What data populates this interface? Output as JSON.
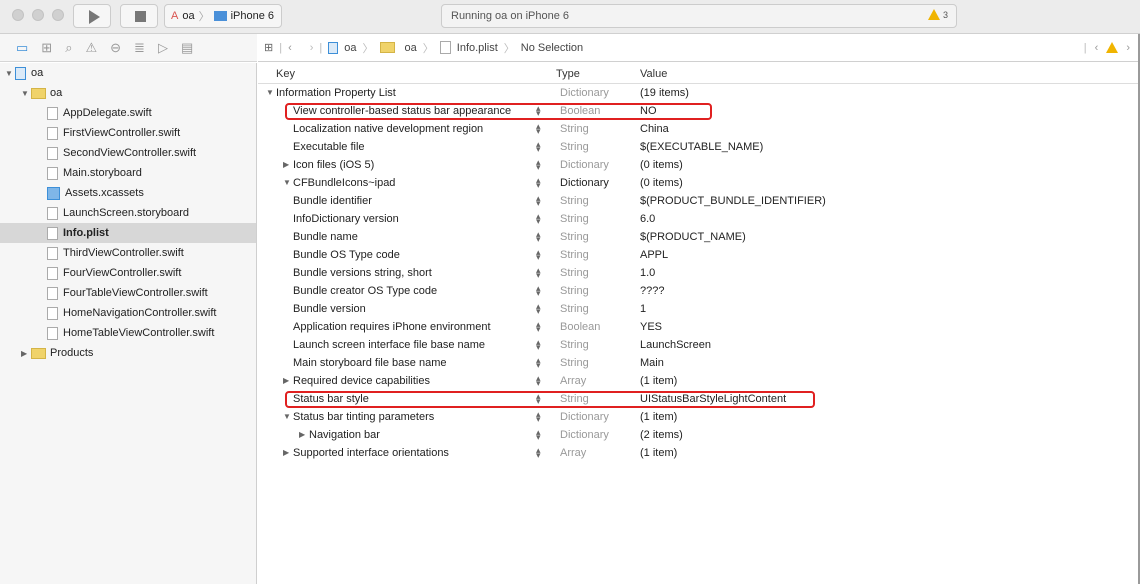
{
  "toolbar": {
    "scheme_project": "oa",
    "scheme_device": "iPhone 6",
    "activity": "Running oa on iPhone 6",
    "warning_count": "3"
  },
  "navigator_icons": [
    "folder-icon",
    "hierarchy-icon",
    "search-icon",
    "warning-icon",
    "test-icon",
    "debug-icon",
    "breakpoint-icon",
    "report-icon"
  ],
  "sidebar": {
    "items": [
      {
        "label": "oa",
        "level": 0,
        "kind": "project",
        "expanded": true
      },
      {
        "label": "oa",
        "level": 1,
        "kind": "folder",
        "expanded": true
      },
      {
        "label": "AppDelegate.swift",
        "level": 2,
        "kind": "file"
      },
      {
        "label": "FirstViewController.swift",
        "level": 2,
        "kind": "file"
      },
      {
        "label": "SecondViewController.swift",
        "level": 2,
        "kind": "file"
      },
      {
        "label": "Main.storyboard",
        "level": 2,
        "kind": "file"
      },
      {
        "label": "Assets.xcassets",
        "level": 2,
        "kind": "assets"
      },
      {
        "label": "LaunchScreen.storyboard",
        "level": 2,
        "kind": "file"
      },
      {
        "label": "Info.plist",
        "level": 2,
        "kind": "file",
        "selected": true
      },
      {
        "label": "ThirdViewController.swift",
        "level": 2,
        "kind": "file"
      },
      {
        "label": "FourViewController.swift",
        "level": 2,
        "kind": "file"
      },
      {
        "label": "FourTableViewController.swift",
        "level": 2,
        "kind": "file"
      },
      {
        "label": "HomeNavigationController.swift",
        "level": 2,
        "kind": "file"
      },
      {
        "label": "HomeTableViewController.swift",
        "level": 2,
        "kind": "file"
      },
      {
        "label": "Products",
        "level": 1,
        "kind": "folder",
        "expanded": false
      }
    ]
  },
  "jumpbar": {
    "crumbs": [
      "oa",
      "oa",
      "Info.plist",
      "No Selection"
    ]
  },
  "plist": {
    "headers": {
      "key": "Key",
      "type": "Type",
      "value": "Value"
    },
    "rows": [
      {
        "key": "Information Property List",
        "type": "Dictionary",
        "value": "(19 items)",
        "indent": 0,
        "disc": "open"
      },
      {
        "key": "View controller-based status bar appearance",
        "type": "Boolean",
        "value": "NO",
        "indent": 1,
        "highlight": true
      },
      {
        "key": "Localization native development region",
        "type": "String",
        "value": "China",
        "indent": 1
      },
      {
        "key": "Executable file",
        "type": "String",
        "value": "$(EXECUTABLE_NAME)",
        "indent": 1
      },
      {
        "key": "Icon files (iOS 5)",
        "type": "Dictionary",
        "value": "(0 items)",
        "indent": 1,
        "disc": "closed"
      },
      {
        "key": "CFBundleIcons~ipad",
        "type": "Dictionary",
        "value": "(0 items)",
        "indent": 1,
        "disc": "open",
        "darktype": true
      },
      {
        "key": "Bundle identifier",
        "type": "String",
        "value": "$(PRODUCT_BUNDLE_IDENTIFIER)",
        "indent": 1
      },
      {
        "key": "InfoDictionary version",
        "type": "String",
        "value": "6.0",
        "indent": 1
      },
      {
        "key": "Bundle name",
        "type": "String",
        "value": "$(PRODUCT_NAME)",
        "indent": 1
      },
      {
        "key": "Bundle OS Type code",
        "type": "String",
        "value": "APPL",
        "indent": 1
      },
      {
        "key": "Bundle versions string, short",
        "type": "String",
        "value": "1.0",
        "indent": 1
      },
      {
        "key": "Bundle creator OS Type code",
        "type": "String",
        "value": "????",
        "indent": 1
      },
      {
        "key": "Bundle version",
        "type": "String",
        "value": "1",
        "indent": 1
      },
      {
        "key": "Application requires iPhone environment",
        "type": "Boolean",
        "value": "YES",
        "indent": 1
      },
      {
        "key": "Launch screen interface file base name",
        "type": "String",
        "value": "LaunchScreen",
        "indent": 1
      },
      {
        "key": "Main storyboard file base name",
        "type": "String",
        "value": "Main",
        "indent": 1
      },
      {
        "key": "Required device capabilities",
        "type": "Array",
        "value": "(1 item)",
        "indent": 1,
        "disc": "closed"
      },
      {
        "key": "Status bar style",
        "type": "String",
        "value": "UIStatusBarStyleLightContent",
        "indent": 1,
        "highlight": true
      },
      {
        "key": "Status bar tinting parameters",
        "type": "Dictionary",
        "value": "(1 item)",
        "indent": 1,
        "disc": "open"
      },
      {
        "key": "Navigation bar",
        "type": "Dictionary",
        "value": "(2 items)",
        "indent": 2,
        "disc": "closed"
      },
      {
        "key": "Supported interface orientations",
        "type": "Array",
        "value": "(1 item)",
        "indent": 1,
        "disc": "closed"
      }
    ]
  },
  "colors": {
    "highlight": "#e02020",
    "selection": "#d7d7d7",
    "warning": "#f0b400"
  }
}
